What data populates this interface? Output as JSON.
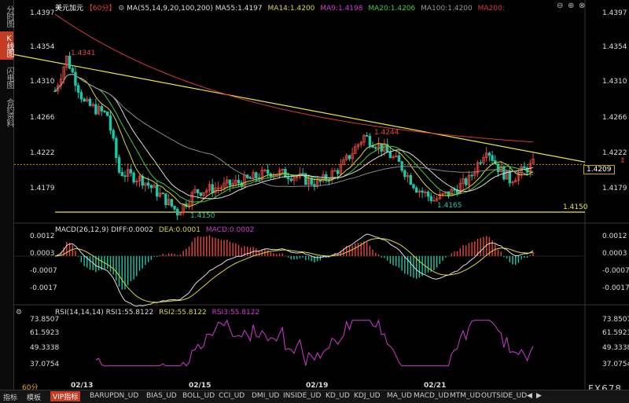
{
  "sidebar": {
    "tabs": [
      {
        "label": "分时图",
        "active": false
      },
      {
        "label": "K线图",
        "active": true
      },
      {
        "label": "闪电图",
        "active": false
      },
      {
        "label": "合约资料",
        "active": false
      }
    ]
  },
  "main_header": {
    "symbol": "美元加元",
    "period": "【60分】",
    "ma_params": "MA(55,14,9,20,100,200)",
    "ma55": "MA55:1.4197",
    "ma14": "MA14:1.4200",
    "ma9": "MA9:1.4198",
    "ma20": "MA20:1.4206",
    "ma100": "MA100:1.4200",
    "ma200": "MA200:"
  },
  "price_axis": [
    "1.4397",
    "1.4354",
    "1.4310",
    "1.4266",
    "1.4222",
    "1.4179"
  ],
  "current_price": "1.4209",
  "annotations": {
    "high1": "1.4341",
    "high2": "1.4244",
    "low1": "1.4150",
    "low2": "1.4165",
    "support": "1.4150"
  },
  "macd_header": {
    "title": "MACD(26,12,9)",
    "diff": "DIFF:0.0002",
    "dea": "DEA:0.0001",
    "macd": "MACD:0.0002"
  },
  "macd_axis": [
    "0.0012",
    "0.0003",
    "-0.0007",
    "-0.0017"
  ],
  "rsi_header": {
    "title": "RSI(14,14,14)",
    "rsi1": "RSI1:55.8122",
    "rsi2": "RSI2:55.8122",
    "rsi3": "RSI3:55.8122"
  },
  "rsi_axis": [
    "73.8507",
    "61.5923",
    "49.3338",
    "37.0754"
  ],
  "dates": [
    "02/13",
    "02/15",
    "02/19",
    "02/21"
  ],
  "bottom": {
    "period_label": "60分",
    "tabs": [
      "指标",
      "模板",
      "VIP指标",
      "BARUPDN_UD",
      "BIAS_UD",
      "BOLL_UD",
      "CCI_UD",
      "DMI_UD",
      "INSIDE_UD",
      "KD_UD",
      "KDJ_UD",
      "MA_UD",
      "MACD_UD",
      "MTM_UD",
      "OUTSIDE_UD"
    ],
    "active_tab": "VIP指标"
  },
  "watermark": "FX678",
  "colors": {
    "up": "#e8453c",
    "down": "#19c8a8",
    "trendline": "#e8e83a",
    "ma_red": "#d8393a",
    "ma_white": "#dddddd",
    "ma_gray": "#888888",
    "ma_green": "#45c845",
    "ma_yellow": "#d8d83a",
    "rsi": "#d23ad2",
    "accent": "#c43c22"
  },
  "chart_data": {
    "type": "candlestick",
    "timeframe": "60分",
    "price_range": [
      1.4135,
      1.4397
    ],
    "swing_points": [
      {
        "label": "1.4341",
        "value": 1.4341,
        "date": "02/12"
      },
      {
        "label": "1.4150",
        "value": 1.415,
        "date": "02/14"
      },
      {
        "label": "1.4244",
        "value": 1.4244,
        "date": "02/19"
      },
      {
        "label": "1.4165",
        "value": 1.4165,
        "date": "02/20"
      }
    ],
    "macd_range": [
      -0.002,
      0.0014
    ],
    "rsi_range": [
      30,
      76
    ]
  }
}
